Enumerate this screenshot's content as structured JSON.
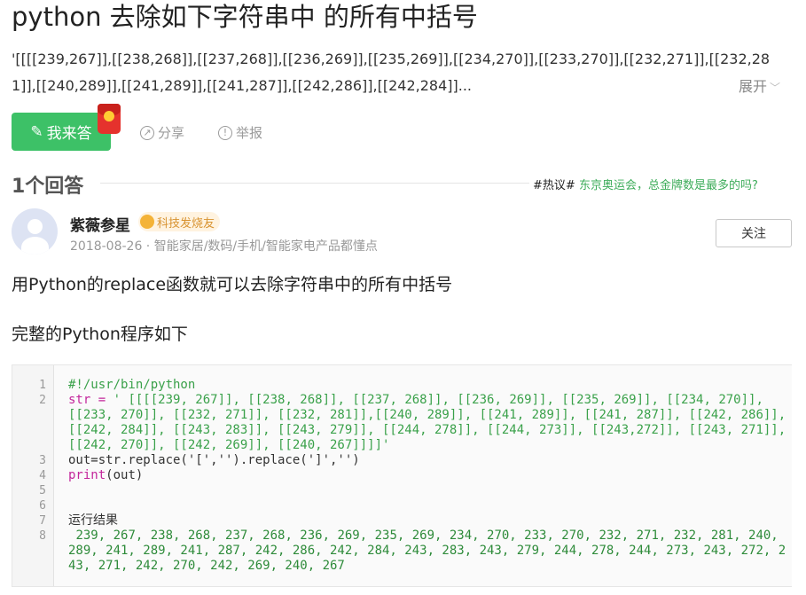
{
  "question": {
    "title": "python 去除如下字符串中 的所有中括号",
    "body": "'[[[[239,267]],[[238,268]],[[237,268]],[[236,269]],[[235,269]],[[234,270]],[[233,270]],[[232,271]],[[232,281]],[[240,289]],[[241,289]],[[241,287]],[[242,286]],[[242,284]]...",
    "expand_label": "展开"
  },
  "actions": {
    "answer_label": "我来答",
    "share_label": "分享",
    "report_label": "举报"
  },
  "answers_header": {
    "count_label": "1个回答",
    "hot_tag": "#热议#",
    "hot_link": "东京奥运会，总金牌数是最多的吗?"
  },
  "answer": {
    "username": "紫薇参星",
    "badge": "科技发烧友",
    "meta": "2018-08-26 · 智能家居/数码/手机/智能家电产品都懂点",
    "follow_label": "关注",
    "para1": "用Python的replace函数就可以去除字符串中的所有中括号",
    "para2": "完整的Python程序如下"
  },
  "code": {
    "line_numbers": [
      "1",
      "2",
      "3",
      "4",
      "5",
      "6",
      "7",
      "8"
    ],
    "shebang": "#!/usr/bin/python",
    "str_name": "str",
    "assign": " = ",
    "str_value": "' [[[[239, 267]], [[238, 268]], [[237, 268]], [[236, 269]], [[235, 269]], [[234, 270]], [[233, 270]], [[232, 271]], [[232, 281]],[[240, 289]], [[241, 289]], [[241, 287]], [[242, 286]], [[242, 284]], [[243, 283]], [[243, 279]], [[244, 278]], [[244, 273]], [[243,272]], [[243, 271]], [[242, 270]], [[242, 269]], [[240, 267]]]]'",
    "line3": "out=str.replace('[','').replace(']','')",
    "print_kw": "print",
    "print_args": "(out)",
    "result_label": "运行结果",
    "result_values": " 239, 267, 238, 268, 237, 268, 236, 269, 235, 269, 234, 270, 233, 270, 232, 271, 232, 281, 240, 289, 241, 289, 241, 287, 242, 286, 242, 284, 243, 283, 243, 279, 244, 278, 244, 273, 243, 272, 243, 271, 242, 270, 242, 269, 240, 267"
  },
  "colors": {
    "accent_green": "#3dc167",
    "link_green": "#3dac5a",
    "red_packet": "#e5322d"
  }
}
